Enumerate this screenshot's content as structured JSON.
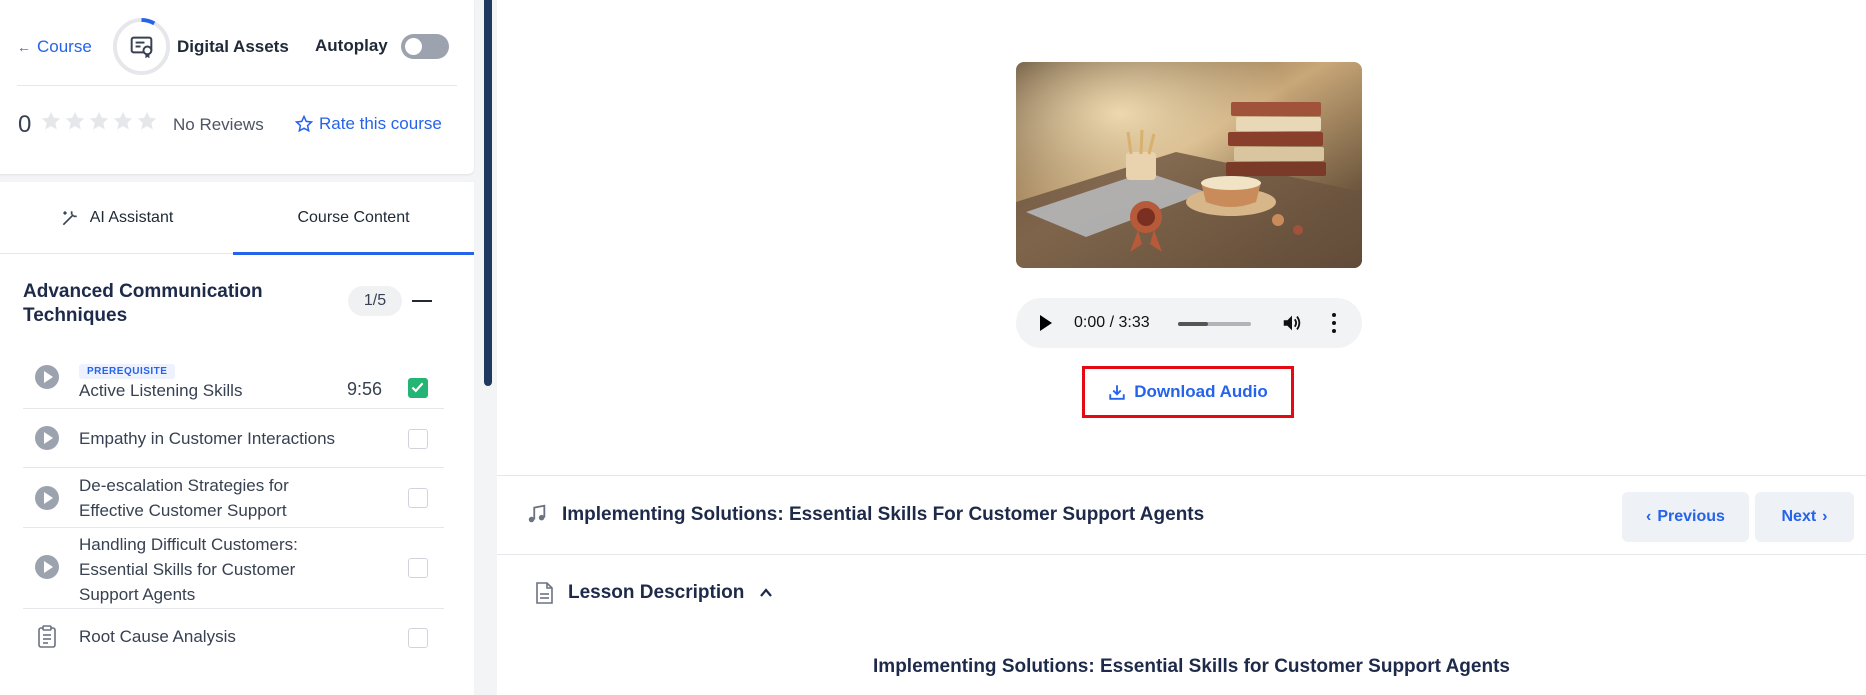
{
  "header": {
    "back_label": "Course",
    "course_name": "Digital Assets",
    "autoplay_label": "Autoplay",
    "autoplay_on": false,
    "progress_fraction": 0.08
  },
  "rating": {
    "value": "0",
    "stars": 0,
    "reviews_label": "No Reviews",
    "rate_label": "Rate this course"
  },
  "tabs": {
    "ai_label": "AI Assistant",
    "content_label": "Course Content",
    "active": "Course Content"
  },
  "section": {
    "title": "Advanced Communication Techniques",
    "count": "1/5"
  },
  "lessons": [
    {
      "title": "Active Listening Skills",
      "badge": "PREREQUISITE",
      "duration": "9:56",
      "checked": true,
      "type": "audio"
    },
    {
      "title": "Empathy in Customer Interactions",
      "checked": false,
      "type": "audio"
    },
    {
      "title": "De-escalation Strategies for Effective Customer Support",
      "checked": false,
      "type": "audio"
    },
    {
      "title": "Handling Difficult Customers: Essential Skills for Customer Support Agents",
      "checked": false,
      "type": "audio"
    },
    {
      "title": "Root Cause Analysis",
      "checked": false,
      "type": "document"
    }
  ],
  "player": {
    "time": "0:00 / 3:33",
    "download_label": "Download Audio"
  },
  "lesson_bar": {
    "title": "Implementing Solutions: Essential Skills For Customer Support Agents",
    "prev_label": "Previous",
    "next_label": "Next"
  },
  "description": {
    "label": "Lesson Description",
    "heading": "Implementing Solutions: Essential Skills for Customer Support Agents"
  },
  "colors": {
    "accent": "#2563eb",
    "check": "#22b573",
    "highlight_border": "#e50914"
  }
}
